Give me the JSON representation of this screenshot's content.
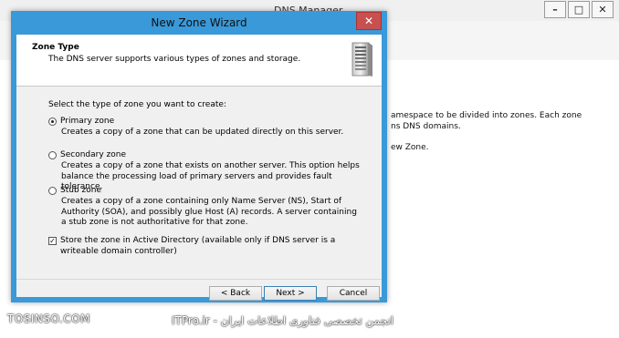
{
  "background_window": {
    "title": "DNS Manager",
    "controls": [
      "–",
      "□",
      "✕"
    ],
    "text_lines": [
      "amespace to be divided into zones. Each zone",
      "ns DNS domains.",
      "ew Zone."
    ]
  },
  "wizard": {
    "title": "New Zone Wizard",
    "close_label": "✕",
    "header_title": "Zone Type",
    "header_subtitle": "The DNS server supports various types of zones and storage.",
    "prompt": "Select the type of zone you want to create:",
    "options": [
      {
        "label": "Primary zone",
        "description": "Creates a copy of a zone that can be updated directly on this server.",
        "selected": true
      },
      {
        "label": "Secondary zone",
        "description": "Creates a copy of a zone that exists on another server. This option helps balance the processing load of primary servers and provides fault tolerance.",
        "selected": false
      },
      {
        "label": "Stub zone",
        "description": "Creates a copy of a zone containing only Name Server (NS), Start of Authority (SOA), and possibly glue Host (A) records. A server containing a stub zone is not authoritative for that zone.",
        "selected": false
      }
    ],
    "store_ad_label": "Store the zone in Active Directory (available only if DNS server is a writeable domain controller)",
    "store_ad_checked": true,
    "buttons": {
      "back": "< Back",
      "next": "Next >",
      "cancel": "Cancel"
    }
  },
  "watermarks": {
    "left": "TOSINSO.COM",
    "right": "ITPro.ir - انجمن تخصصی فناوری اطلاعات ایران"
  },
  "colors": {
    "title_bar": "#3a99d8",
    "close_button": "#c75050"
  }
}
